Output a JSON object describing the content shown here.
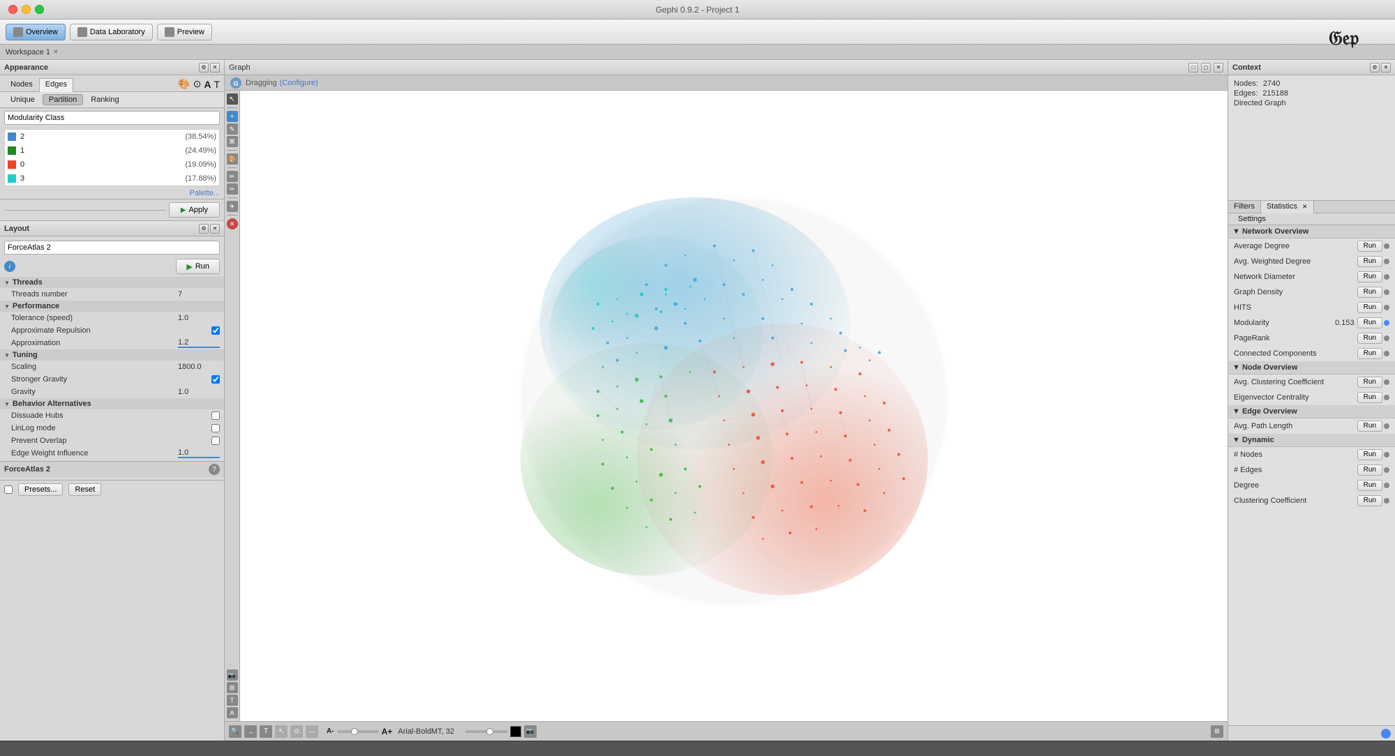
{
  "window": {
    "title": "Gephi 0.9.2 - Project 1"
  },
  "toolbar": {
    "overview_label": "Overview",
    "data_laboratory_label": "Data Laboratory",
    "preview_label": "Preview"
  },
  "workspace": {
    "tab_label": "Workspace 1"
  },
  "appearance": {
    "panel_title": "Appearance",
    "tabs": [
      "Nodes",
      "Edges"
    ],
    "active_tab": "Edges",
    "sub_tabs": [
      "Unique",
      "Partition",
      "Ranking"
    ],
    "active_sub_tab": "Partition",
    "dropdown_value": "Modularity Class",
    "color_items": [
      {
        "label": "2",
        "pct": "(38.54%)",
        "color": "#4488cc"
      },
      {
        "label": "1",
        "pct": "(24.49%)",
        "color": "#228822"
      },
      {
        "label": "0",
        "pct": "(19.09%)",
        "color": "#ee4422"
      },
      {
        "label": "3",
        "pct": "(17.88%)",
        "color": "#22cccc"
      }
    ],
    "palette_label": "Palette...",
    "apply_label": "Apply"
  },
  "layout": {
    "panel_title": "Layout",
    "dropdown_value": "ForceAtlas 2",
    "run_label": "Run",
    "threads_section": "Threads",
    "threads_number_label": "Threads number",
    "threads_number_value": "7",
    "performance_section": "Performance",
    "tolerance_label": "Tolerance (speed)",
    "tolerance_value": "1.0",
    "approx_repulsion_label": "Approximate Repulsion",
    "approx_repulsion_value": true,
    "approximation_label": "Approximation",
    "approximation_value": "1.2",
    "tuning_section": "Tuning",
    "scaling_label": "Scaling",
    "scaling_value": "1800.0",
    "stronger_gravity_label": "Stronger Gravity",
    "stronger_gravity_value": true,
    "gravity_label": "Gravity",
    "gravity_value": "1.0",
    "behavior_section": "Behavior Alternatives",
    "dissuade_hubs_label": "Dissuade Hubs",
    "dissuade_hubs_value": false,
    "linlog_label": "LinLog mode",
    "linlog_value": false,
    "prevent_overlap_label": "Prevent Overlap",
    "prevent_overlap_value": false,
    "edge_weight_label": "Edge Weight Influence",
    "edge_weight_value": "1.0",
    "algorithm_label": "ForceAtlas 2",
    "presets_label": "Presets...",
    "reset_label": "Reset"
  },
  "graph": {
    "tab_label": "Graph",
    "status_text": "Dragging",
    "configure_label": "(Configure)"
  },
  "context": {
    "panel_title": "Context",
    "nodes_label": "Nodes:",
    "nodes_value": "2740",
    "edges_label": "Edges:",
    "edges_value": "215188",
    "graph_type_label": "Directed Graph"
  },
  "statistics": {
    "panel_title": "Statistics",
    "filters_tab": "Filters",
    "statistics_tab": "Statistics",
    "settings_tab": "Settings",
    "network_overview_label": "▼ Network Overview",
    "avg_degree_label": "Average Degree",
    "avg_weighted_degree_label": "Avg. Weighted Degree",
    "network_diameter_label": "Network Diameter",
    "graph_density_label": "Graph Density",
    "hits_label": "HITS",
    "modularity_label": "Modularity",
    "modularity_value": "0.153",
    "pagerank_label": "PageRank",
    "connected_components_label": "Connected Components",
    "node_overview_label": "▼ Node Overview",
    "avg_clustering_label": "Avg. Clustering Coefficient",
    "eigenvector_label": "Eigenvector Centrality",
    "edge_overview_label": "▼ Edge Overview",
    "avg_path_label": "Avg. Path Length",
    "dynamic_label": "▼ Dynamic",
    "num_nodes_label": "# Nodes",
    "num_edges_label": "# Edges",
    "degree_label": "Degree",
    "clustering_coeff_label": "Clustering Coefficient",
    "run_label": "Run"
  },
  "bottom_toolbar": {
    "font_name": "Arial-BoldMT, 32"
  }
}
